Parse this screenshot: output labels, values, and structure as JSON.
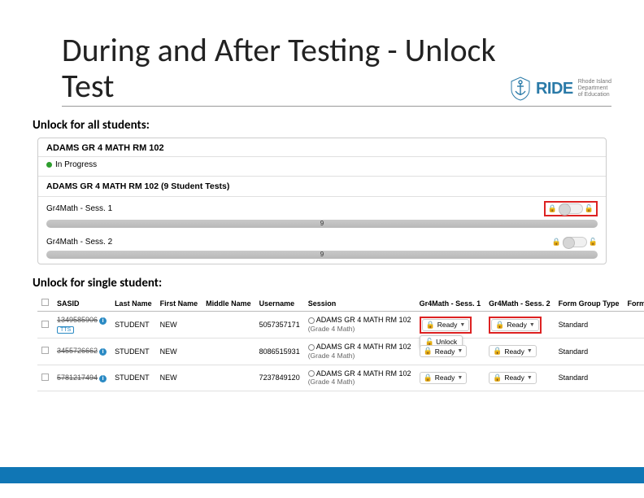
{
  "title": "During and After Testing - Unlock Test",
  "logo": {
    "name": "RIDE",
    "sub1": "Rhode Island",
    "sub2": "Department",
    "sub3": "of Education"
  },
  "section1_label": "Unlock for all students:",
  "section2_label": "Unlock for single student:",
  "panel": {
    "header": "ADAMS GR 4 MATH RM 102",
    "status": "In Progress",
    "sub_header": "ADAMS GR 4 MATH RM 102 (9 Student Tests)",
    "sessions": [
      {
        "label": "Gr4Math - Sess. 1",
        "count": "9",
        "highlighted": true
      },
      {
        "label": "Gr4Math - Sess. 2",
        "count": "9",
        "highlighted": false
      }
    ]
  },
  "table": {
    "headers": {
      "cb": "",
      "sasid": "SASID",
      "last": "Last Name",
      "first": "First Name",
      "middle": "Middle Name",
      "user": "Username",
      "session": "Session",
      "s1": "Gr4Math - Sess. 1",
      "s2": "Gr4Math - Sess. 2",
      "fgt": "Form Group Type",
      "form": "Form"
    },
    "unlock_label": "Unlock",
    "ready_label": "Ready",
    "rows": [
      {
        "sasid": "1349585906",
        "tts": "TTS",
        "last": "STUDENT",
        "first": "NEW",
        "user": "5057357171",
        "session_top": "ADAMS GR 4 MATH RM 102",
        "session_sub": "(Grade 4 Math)",
        "s1_red": true,
        "s2_red": true,
        "fgt": "Standard",
        "show_unlock": true
      },
      {
        "sasid": "3455726662",
        "tts": "",
        "last": "STUDENT",
        "first": "NEW",
        "user": "8086515931",
        "session_top": "ADAMS GR 4 MATH RM 102",
        "session_sub": "(Grade 4 Math)",
        "s1_red": false,
        "s2_red": false,
        "fgt": "Standard",
        "show_unlock": false
      },
      {
        "sasid": "5781217494",
        "tts": "",
        "last": "STUDENT",
        "first": "NEW",
        "user": "7237849120",
        "session_top": "ADAMS GR 4 MATH RM 102",
        "session_sub": "(Grade 4 Math)",
        "s1_red": false,
        "s2_red": false,
        "fgt": "Standard",
        "show_unlock": false
      }
    ]
  }
}
